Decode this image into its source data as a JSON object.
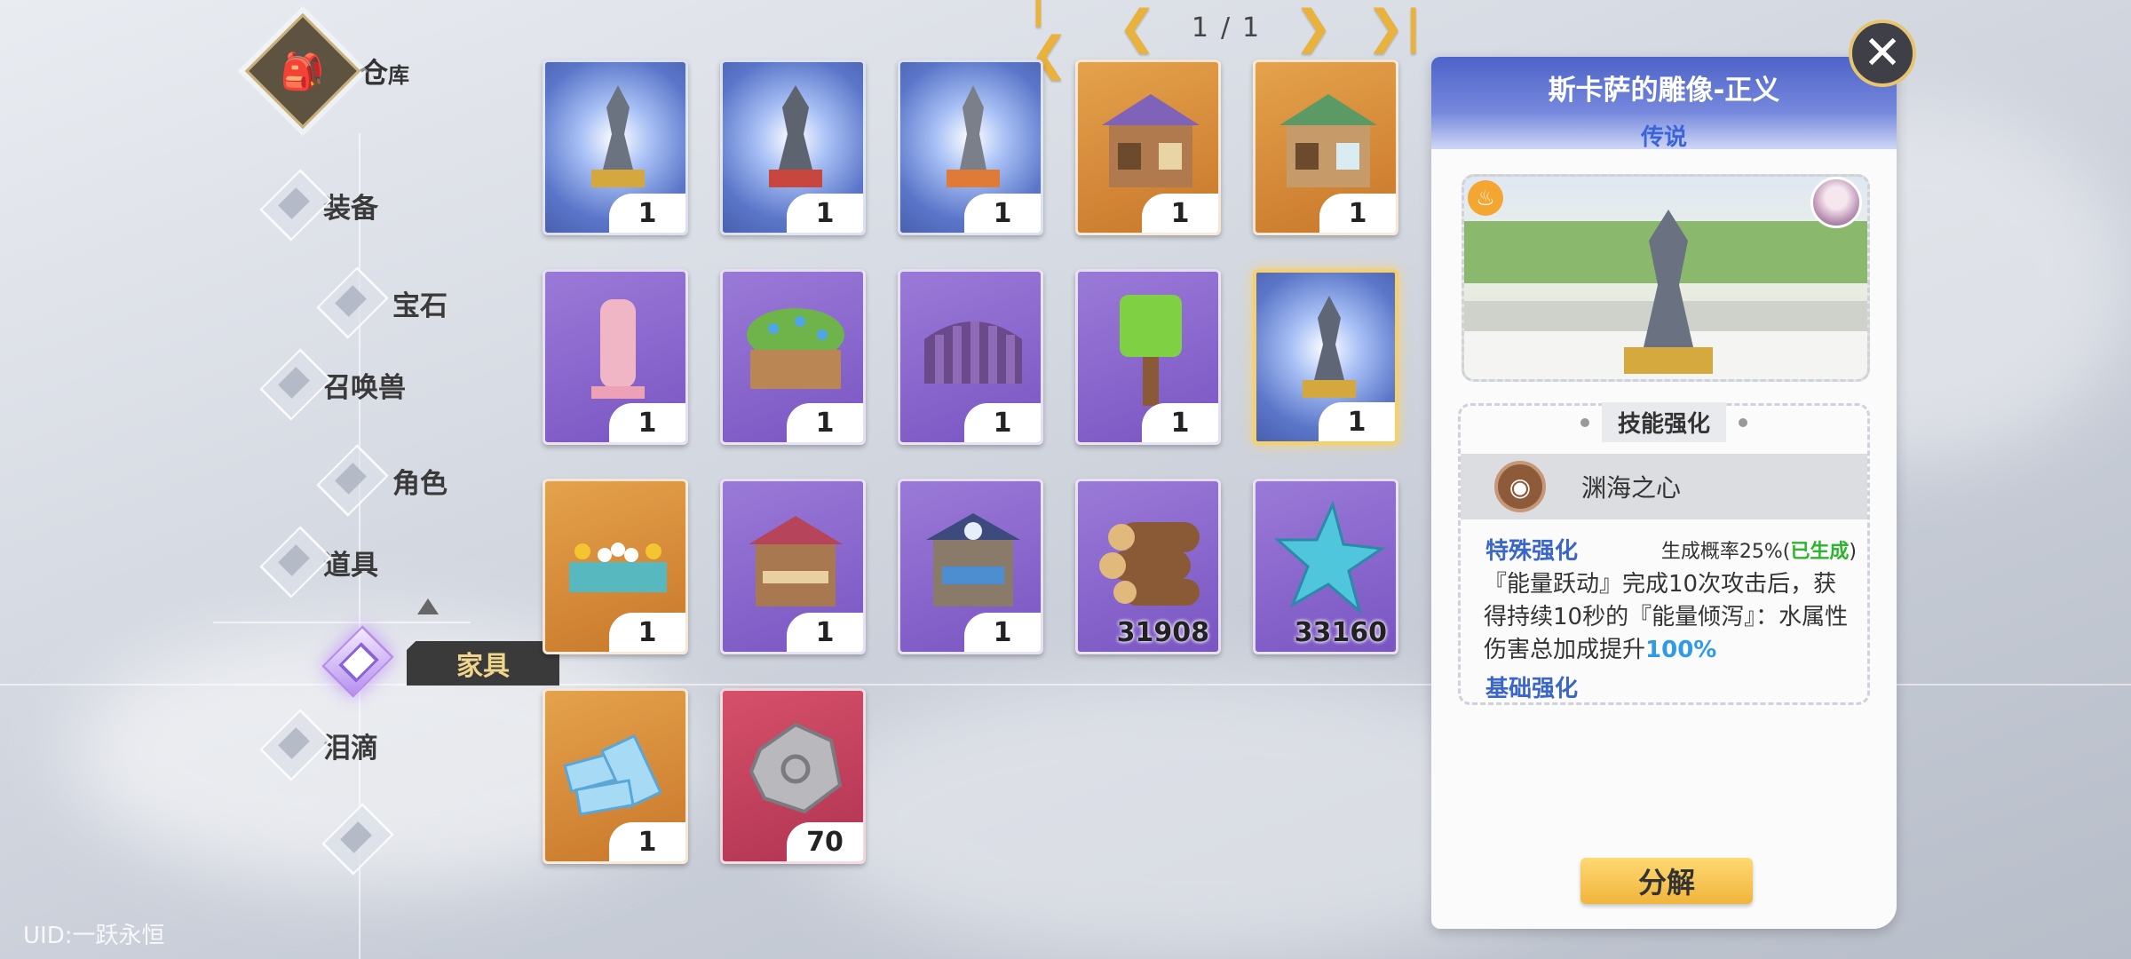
{
  "nav": {
    "warehouse_title": "仓",
    "warehouse_sub": "库",
    "items": [
      {
        "label": "装备"
      },
      {
        "label": "宝石"
      },
      {
        "label": "召唤兽"
      },
      {
        "label": "角色"
      },
      {
        "label": "道具"
      },
      {
        "label": "家具"
      },
      {
        "label": "泪滴"
      }
    ],
    "active_tooltip": "家具",
    "uid": "UID:一跃永恒"
  },
  "pager": {
    "first": "|❮",
    "prev": "❮",
    "current": "1",
    "separator": "/",
    "total": "1",
    "next": "❯",
    "last": "❯|"
  },
  "grid": {
    "items": [
      {
        "qty": "1",
        "kind": "statue-blue"
      },
      {
        "qty": "1",
        "kind": "statue-red"
      },
      {
        "qty": "1",
        "kind": "statue-orange"
      },
      {
        "qty": "1",
        "kind": "shop-purple-roof"
      },
      {
        "qty": "1",
        "kind": "shop-green-roof"
      },
      {
        "qty": "1",
        "kind": "pink-statue"
      },
      {
        "qty": "1",
        "kind": "flower-planter"
      },
      {
        "qty": "1",
        "kind": "wooden-fence"
      },
      {
        "qty": "1",
        "kind": "green-tree"
      },
      {
        "qty": "1",
        "kind": "statue-selected"
      },
      {
        "qty": "1",
        "kind": "flower-bed"
      },
      {
        "qty": "1",
        "kind": "bakery-building"
      },
      {
        "qty": "1",
        "kind": "blue-shop-building"
      },
      {
        "qty": "31908",
        "kind": "wood-logs"
      },
      {
        "qty": "33160",
        "kind": "blue-star"
      },
      {
        "qty": "1",
        "kind": "ice-bricks"
      },
      {
        "qty": "70",
        "kind": "stone-ore"
      }
    ]
  },
  "detail": {
    "title": "斯卡萨的雕像-正义",
    "rarity": "传说",
    "skill_section": "技能强化",
    "skill_name": "渊海之心",
    "special_label": "特殊强化",
    "special_rate": "生成概率25%(",
    "special_status": "已生成",
    "special_rate_end": ")",
    "special_desc_1": "『能量跃动』完成10次攻击后，获得持续10秒的『能量倾泻』：水属性伤害总加成提升",
    "special_value": "100%",
    "basic_label": "基础强化",
    "decompose_label": "分解",
    "close_label": "✕"
  },
  "colors": {
    "accent_gold": "#e9b23d",
    "rarity_blue": "#3b64d6",
    "status_green": "#2db42d",
    "value_blue": "#2f9be6"
  }
}
